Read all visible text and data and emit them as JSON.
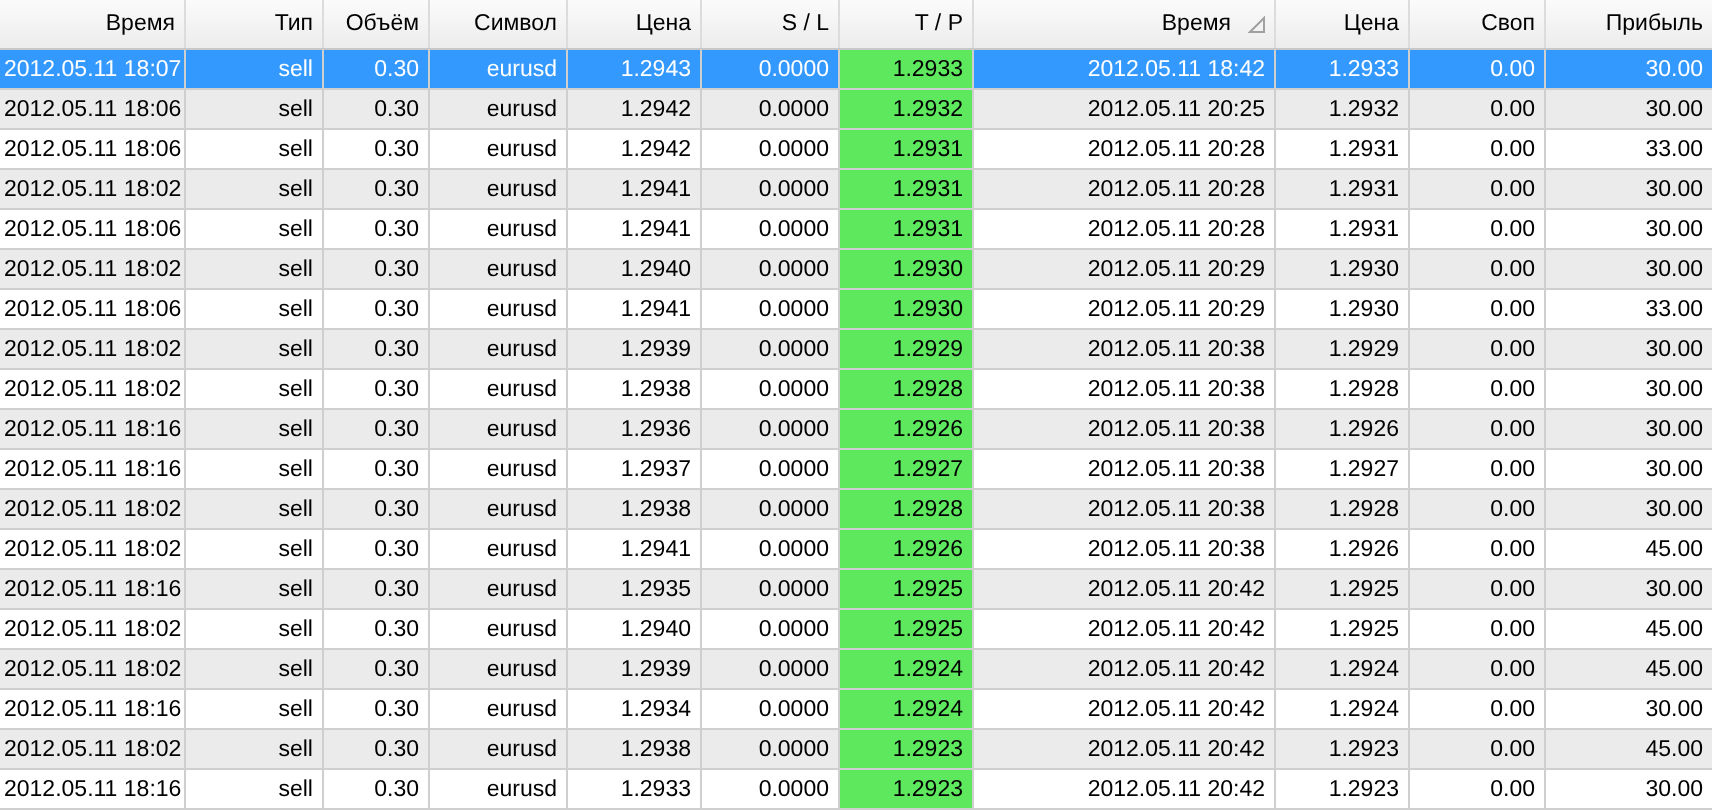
{
  "table": {
    "columns": [
      {
        "label": "Время",
        "sorted": false,
        "highlighted": false
      },
      {
        "label": "Тип",
        "sorted": false,
        "highlighted": false
      },
      {
        "label": "Объём",
        "sorted": false,
        "highlighted": false
      },
      {
        "label": "Символ",
        "sorted": false,
        "highlighted": false
      },
      {
        "label": "Цена",
        "sorted": false,
        "highlighted": false
      },
      {
        "label": "S / L",
        "sorted": false,
        "highlighted": false
      },
      {
        "label": "T / P",
        "sorted": false,
        "highlighted": true
      },
      {
        "label": "Время",
        "sorted": true,
        "highlighted": false
      },
      {
        "label": "Цена",
        "sorted": false,
        "highlighted": false
      },
      {
        "label": "Своп",
        "sorted": false,
        "highlighted": false
      },
      {
        "label": "Прибыль",
        "sorted": false,
        "highlighted": false
      }
    ],
    "rows": [
      {
        "selected": true,
        "cells": [
          "2012.05.11 18:07",
          "sell",
          "0.30",
          "eurusd",
          "1.2943",
          "0.0000",
          "1.2933",
          "2012.05.11 18:42",
          "1.2933",
          "0.00",
          "30.00"
        ]
      },
      {
        "selected": false,
        "cells": [
          "2012.05.11 18:06",
          "sell",
          "0.30",
          "eurusd",
          "1.2942",
          "0.0000",
          "1.2932",
          "2012.05.11 20:25",
          "1.2932",
          "0.00",
          "30.00"
        ]
      },
      {
        "selected": false,
        "cells": [
          "2012.05.11 18:06",
          "sell",
          "0.30",
          "eurusd",
          "1.2942",
          "0.0000",
          "1.2931",
          "2012.05.11 20:28",
          "1.2931",
          "0.00",
          "33.00"
        ]
      },
      {
        "selected": false,
        "cells": [
          "2012.05.11 18:02",
          "sell",
          "0.30",
          "eurusd",
          "1.2941",
          "0.0000",
          "1.2931",
          "2012.05.11 20:28",
          "1.2931",
          "0.00",
          "30.00"
        ]
      },
      {
        "selected": false,
        "cells": [
          "2012.05.11 18:06",
          "sell",
          "0.30",
          "eurusd",
          "1.2941",
          "0.0000",
          "1.2931",
          "2012.05.11 20:28",
          "1.2931",
          "0.00",
          "30.00"
        ]
      },
      {
        "selected": false,
        "cells": [
          "2012.05.11 18:02",
          "sell",
          "0.30",
          "eurusd",
          "1.2940",
          "0.0000",
          "1.2930",
          "2012.05.11 20:29",
          "1.2930",
          "0.00",
          "30.00"
        ]
      },
      {
        "selected": false,
        "cells": [
          "2012.05.11 18:06",
          "sell",
          "0.30",
          "eurusd",
          "1.2941",
          "0.0000",
          "1.2930",
          "2012.05.11 20:29",
          "1.2930",
          "0.00",
          "33.00"
        ]
      },
      {
        "selected": false,
        "cells": [
          "2012.05.11 18:02",
          "sell",
          "0.30",
          "eurusd",
          "1.2939",
          "0.0000",
          "1.2929",
          "2012.05.11 20:38",
          "1.2929",
          "0.00",
          "30.00"
        ]
      },
      {
        "selected": false,
        "cells": [
          "2012.05.11 18:02",
          "sell",
          "0.30",
          "eurusd",
          "1.2938",
          "0.0000",
          "1.2928",
          "2012.05.11 20:38",
          "1.2928",
          "0.00",
          "30.00"
        ]
      },
      {
        "selected": false,
        "cells": [
          "2012.05.11 18:16",
          "sell",
          "0.30",
          "eurusd",
          "1.2936",
          "0.0000",
          "1.2926",
          "2012.05.11 20:38",
          "1.2926",
          "0.00",
          "30.00"
        ]
      },
      {
        "selected": false,
        "cells": [
          "2012.05.11 18:16",
          "sell",
          "0.30",
          "eurusd",
          "1.2937",
          "0.0000",
          "1.2927",
          "2012.05.11 20:38",
          "1.2927",
          "0.00",
          "30.00"
        ]
      },
      {
        "selected": false,
        "cells": [
          "2012.05.11 18:02",
          "sell",
          "0.30",
          "eurusd",
          "1.2938",
          "0.0000",
          "1.2928",
          "2012.05.11 20:38",
          "1.2928",
          "0.00",
          "30.00"
        ]
      },
      {
        "selected": false,
        "cells": [
          "2012.05.11 18:02",
          "sell",
          "0.30",
          "eurusd",
          "1.2941",
          "0.0000",
          "1.2926",
          "2012.05.11 20:38",
          "1.2926",
          "0.00",
          "45.00"
        ]
      },
      {
        "selected": false,
        "cells": [
          "2012.05.11 18:16",
          "sell",
          "0.30",
          "eurusd",
          "1.2935",
          "0.0000",
          "1.2925",
          "2012.05.11 20:42",
          "1.2925",
          "0.00",
          "30.00"
        ]
      },
      {
        "selected": false,
        "cells": [
          "2012.05.11 18:02",
          "sell",
          "0.30",
          "eurusd",
          "1.2940",
          "0.0000",
          "1.2925",
          "2012.05.11 20:42",
          "1.2925",
          "0.00",
          "45.00"
        ]
      },
      {
        "selected": false,
        "cells": [
          "2012.05.11 18:02",
          "sell",
          "0.30",
          "eurusd",
          "1.2939",
          "0.0000",
          "1.2924",
          "2012.05.11 20:42",
          "1.2924",
          "0.00",
          "45.00"
        ]
      },
      {
        "selected": false,
        "cells": [
          "2012.05.11 18:16",
          "sell",
          "0.30",
          "eurusd",
          "1.2934",
          "0.0000",
          "1.2924",
          "2012.05.11 20:42",
          "1.2924",
          "0.00",
          "30.00"
        ]
      },
      {
        "selected": false,
        "cells": [
          "2012.05.11 18:02",
          "sell",
          "0.30",
          "eurusd",
          "1.2938",
          "0.0000",
          "1.2923",
          "2012.05.11 20:42",
          "1.2923",
          "0.00",
          "45.00"
        ]
      },
      {
        "selected": false,
        "cells": [
          "2012.05.11 18:16",
          "sell",
          "0.30",
          "eurusd",
          "1.2933",
          "0.0000",
          "1.2923",
          "2012.05.11 20:42",
          "1.2923",
          "0.00",
          "30.00"
        ]
      }
    ]
  }
}
